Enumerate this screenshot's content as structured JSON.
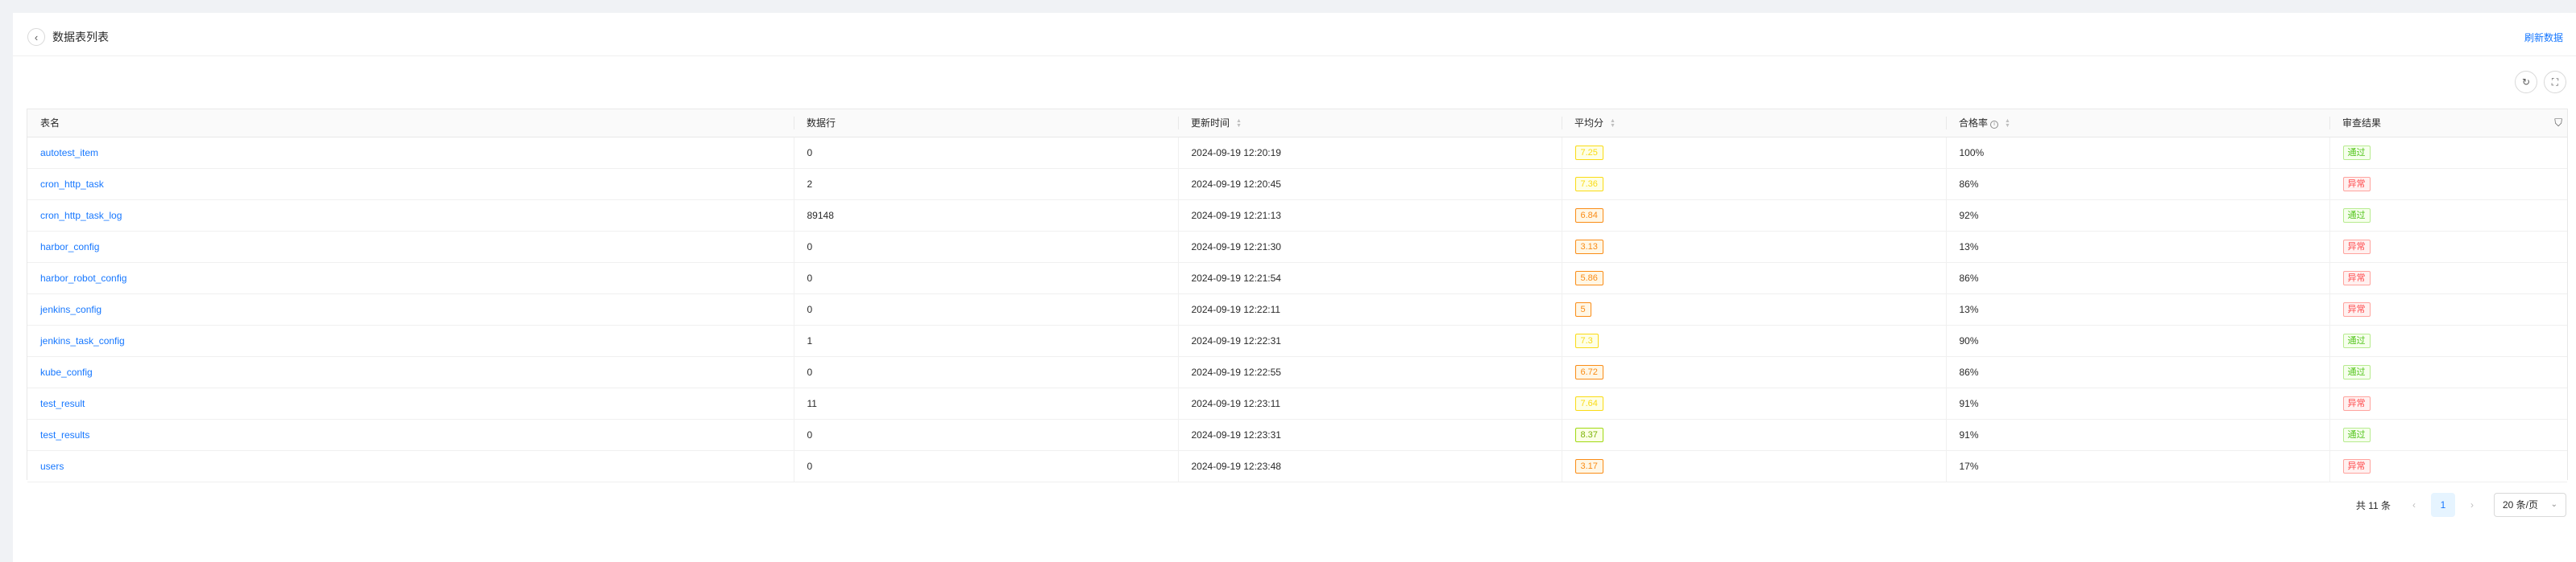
{
  "header": {
    "back_icon": "chevron-left-icon",
    "title": "数据表列表",
    "refresh_label": "刷新数据"
  },
  "toolbar": {
    "reload_icon": "reload-icon",
    "fullscreen_icon": "fullscreen-icon"
  },
  "table": {
    "columns": [
      "表名",
      "数据行",
      "更新时间",
      "平均分",
      "合格率",
      "审查结果"
    ],
    "rows": [
      {
        "name": "autotest_item",
        "rows": "0",
        "updated": "2024-09-19 12:20:19",
        "score": "7.25",
        "score_color": "yellow",
        "rate": "100%",
        "result": "通过",
        "result_type": "pass"
      },
      {
        "name": "cron_http_task",
        "rows": "2",
        "updated": "2024-09-19 12:20:45",
        "score": "7.36",
        "score_color": "yellow",
        "rate": "86%",
        "result": "异常",
        "result_type": "fail"
      },
      {
        "name": "cron_http_task_log",
        "rows": "89148",
        "updated": "2024-09-19 12:21:13",
        "score": "6.84",
        "score_color": "orange",
        "rate": "92%",
        "result": "通过",
        "result_type": "pass"
      },
      {
        "name": "harbor_config",
        "rows": "0",
        "updated": "2024-09-19 12:21:30",
        "score": "3.13",
        "score_color": "orange",
        "rate": "13%",
        "result": "异常",
        "result_type": "fail"
      },
      {
        "name": "harbor_robot_config",
        "rows": "0",
        "updated": "2024-09-19 12:21:54",
        "score": "5.86",
        "score_color": "orange",
        "rate": "86%",
        "result": "异常",
        "result_type": "fail"
      },
      {
        "name": "jenkins_config",
        "rows": "0",
        "updated": "2024-09-19 12:22:11",
        "score": "5",
        "score_color": "orange",
        "rate": "13%",
        "result": "异常",
        "result_type": "fail"
      },
      {
        "name": "jenkins_task_config",
        "rows": "1",
        "updated": "2024-09-19 12:22:31",
        "score": "7.3",
        "score_color": "yellow",
        "rate": "90%",
        "result": "通过",
        "result_type": "pass"
      },
      {
        "name": "kube_config",
        "rows": "0",
        "updated": "2024-09-19 12:22:55",
        "score": "6.72",
        "score_color": "orange",
        "rate": "86%",
        "result": "通过",
        "result_type": "pass"
      },
      {
        "name": "test_result",
        "rows": "11",
        "updated": "2024-09-19 12:23:11",
        "score": "7.64",
        "score_color": "yellow",
        "rate": "91%",
        "result": "异常",
        "result_type": "fail"
      },
      {
        "name": "test_results",
        "rows": "0",
        "updated": "2024-09-19 12:23:31",
        "score": "8.37",
        "score_color": "lime",
        "rate": "91%",
        "result": "通过",
        "result_type": "pass"
      },
      {
        "name": "users",
        "rows": "0",
        "updated": "2024-09-19 12:23:48",
        "score": "3.17",
        "score_color": "orange",
        "rate": "17%",
        "result": "异常",
        "result_type": "fail"
      }
    ]
  },
  "pagination": {
    "total_label": "共 11 条",
    "current_page": "1",
    "page_size_label": "20 条/页"
  }
}
